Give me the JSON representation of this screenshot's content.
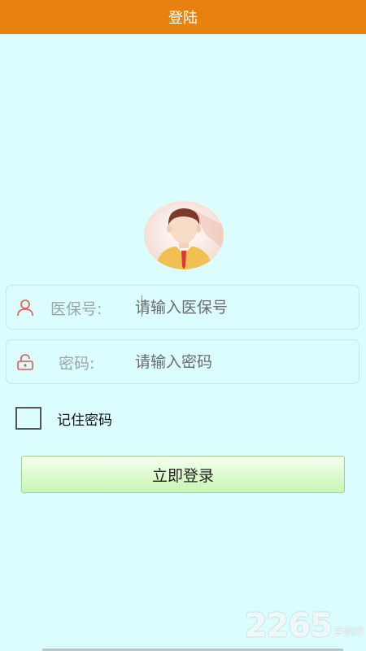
{
  "header": {
    "title": "登陆"
  },
  "form": {
    "id_field": {
      "label": "医保号:",
      "placeholder": "请输入医保号",
      "icon": "user-icon"
    },
    "password_field": {
      "label": "密码:",
      "placeholder": "请输入密码",
      "icon": "lock-icon"
    },
    "remember": {
      "label": "记住密码",
      "checked": false
    },
    "submit_label": "立即登录"
  },
  "watermark": {
    "number": "2265",
    "text": "手游网"
  },
  "colors": {
    "header": "#e8820e",
    "background": "#dcfdfd",
    "accent_icon": "#e05a4f",
    "button": "#c8f5b4"
  }
}
